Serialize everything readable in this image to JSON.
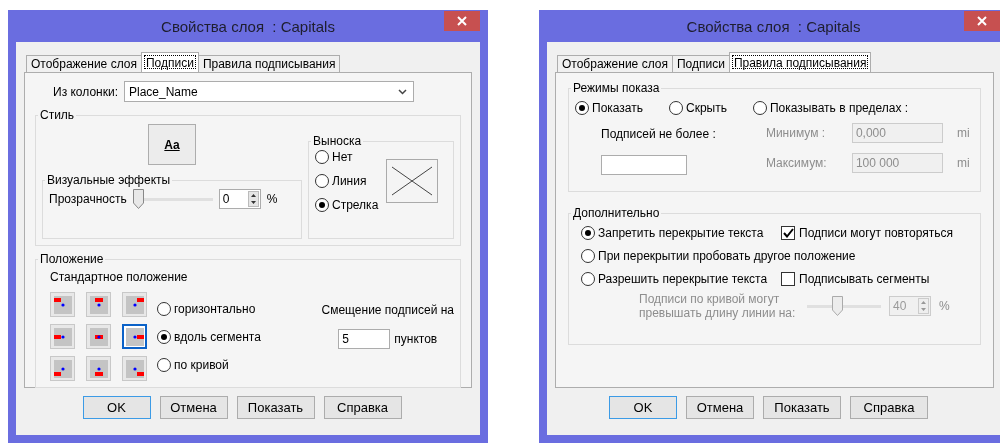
{
  "dialogs": [
    {
      "kind": "labels",
      "title": "Свойства слоя  : Capitals",
      "tabs": [
        {
          "label": "Отображение слоя",
          "selected": false
        },
        {
          "label": "Подписи",
          "selected": true
        },
        {
          "label": "Правила подписывания",
          "selected": false
        }
      ],
      "column": {
        "label": "Из колонки:",
        "value": "Place_Name"
      },
      "style": {
        "title": "Стиль",
        "button": "Aa",
        "effects": {
          "title": "Визуальные эффекты",
          "label": "Прозрачность",
          "level": 0,
          "value": "0",
          "unit": "%"
        },
        "callout": {
          "title": "Выноска",
          "options": [
            {
              "label": "Нет",
              "selected": false
            },
            {
              "label": "Линия",
              "selected": false
            },
            {
              "label": "Стрелка",
              "selected": true
            }
          ]
        }
      },
      "position": {
        "title": "Положение",
        "subtitle": "Стандартное положение",
        "anchors": [
          {
            "selected": false
          },
          {
            "selected": false
          },
          {
            "selected": false
          },
          {
            "selected": false
          },
          {
            "selected": false
          },
          {
            "selected": true
          },
          {
            "selected": false
          },
          {
            "selected": false
          },
          {
            "selected": false
          }
        ],
        "orientation": [
          {
            "label": "горизонтально",
            "selected": false
          },
          {
            "label": "вдоль сегмента",
            "selected": true
          },
          {
            "label": "по кривой",
            "selected": false
          }
        ],
        "offset": {
          "label": "Смещение подписей на",
          "value": "5",
          "unit": "пунктов"
        }
      },
      "buttons": [
        {
          "label": "OK",
          "default": true
        },
        {
          "label": "Отмена",
          "default": false
        },
        {
          "label": "Показать",
          "default": false
        },
        {
          "label": "Справка",
          "default": false
        }
      ]
    },
    {
      "kind": "rules",
      "title": "Свойства слоя  : Capitals",
      "tabs": [
        {
          "label": "Отображение слоя",
          "selected": false
        },
        {
          "label": "Подписи",
          "selected": false
        },
        {
          "label": "Правила подписывания",
          "selected": true
        }
      ],
      "display": {
        "title": "Режимы показа",
        "modes": [
          {
            "label": "Показать",
            "selected": true
          },
          {
            "label": "Скрыть",
            "selected": false
          },
          {
            "label": "Показывать в пределах :",
            "selected": false
          }
        ],
        "max_labels": {
          "label": "Подписей не более :"
        },
        "range": [
          {
            "label": "Минимум :",
            "value": "0,000",
            "unit": "mi",
            "disabled": true
          },
          {
            "label": "Максимум:",
            "value": "100 000",
            "unit": "mi",
            "disabled": true
          }
        ]
      },
      "extra": {
        "title": "Дополнительно",
        "overlap": [
          {
            "label": "Запретить перекрытие текста",
            "selected": true
          },
          {
            "label": "При перекрытии пробовать другое положение",
            "selected": false
          },
          {
            "label": "Разрешить перекрытие текста",
            "selected": false
          }
        ],
        "checks": [
          {
            "label": "Подписи могут повторяться",
            "checked": true
          },
          {
            "label": "Подписывать сегменты",
            "checked": false
          }
        ],
        "curve": {
          "label": "Подписи по кривой могут превышать длину линии на:",
          "level": 0.4,
          "value": "40",
          "unit": "%",
          "disabled": true
        }
      },
      "buttons": [
        {
          "label": "OK",
          "default": true
        },
        {
          "label": "Отмена",
          "default": false
        },
        {
          "label": "Показать",
          "default": false
        },
        {
          "label": "Справка",
          "default": false
        }
      ]
    }
  ]
}
